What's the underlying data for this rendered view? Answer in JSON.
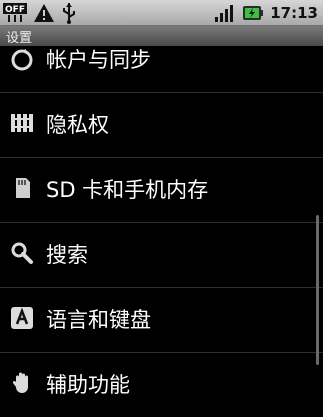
{
  "status_bar": {
    "time": "17:13",
    "left_icons": [
      "usb-off-icon",
      "warning-icon",
      "usb-icon"
    ],
    "right_icons": [
      "signal-icon",
      "battery-icon"
    ]
  },
  "title_bar": {
    "title": "设置"
  },
  "settings": {
    "items": [
      {
        "label": "帐户与同步",
        "icon": "sync-icon"
      },
      {
        "label": "隐私权",
        "icon": "privacy-icon"
      },
      {
        "label": "SD 卡和手机内存",
        "icon": "sd-card-icon"
      },
      {
        "label": "搜索",
        "icon": "search-icon"
      },
      {
        "label": "语言和键盘",
        "icon": "keyboard-icon"
      },
      {
        "label": "辅助功能",
        "icon": "accessibility-icon"
      }
    ]
  },
  "colors": {
    "background": "#000000",
    "status_bar": "#bfbfbf",
    "title_bar": "#5a5a5a",
    "text": "#ffffff"
  }
}
